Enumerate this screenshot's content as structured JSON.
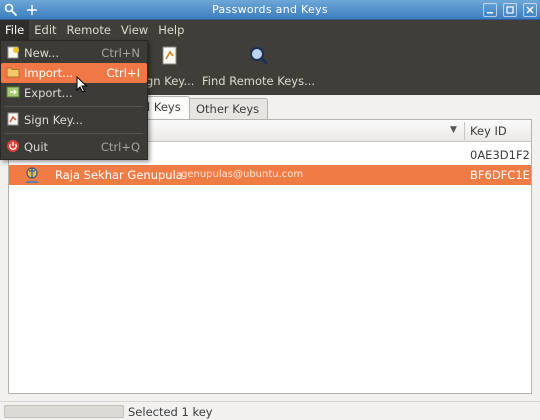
{
  "window": {
    "title": "Passwords and Keys"
  },
  "menubar": {
    "items": [
      "File",
      "Edit",
      "Remote",
      "View",
      "Help"
    ]
  },
  "toolbar": {
    "sign_key_label": "gn Key...",
    "find_remote_label": "Find Remote Keys..."
  },
  "file_menu": {
    "items": [
      {
        "label": "New...",
        "shortcut": "Ctrl+N"
      },
      {
        "label": "Import...",
        "shortcut": "Ctrl+I"
      },
      {
        "label": "Export...",
        "shortcut": ""
      },
      {
        "label": "Sign Key...",
        "shortcut": ""
      },
      {
        "label": "Quit",
        "shortcut": "Ctrl+Q"
      }
    ]
  },
  "tabs": {
    "my_keys": "l Keys",
    "other_keys": "Other Keys"
  },
  "table": {
    "key_id_header": "Key ID",
    "rows": [
      {
        "name": "",
        "email": "",
        "key_id": "0AE3D1F2"
      },
      {
        "name": "Raja Sekhar Genupula",
        "email": "genupulas@ubuntu.com",
        "key_id": "BF6DFC1E"
      }
    ]
  },
  "status": {
    "text": "Selected 1 key"
  },
  "colors": {
    "accent": "#ef7b45",
    "titlebar": "#4f8ecb",
    "menu_bg": "#3c3b37"
  }
}
